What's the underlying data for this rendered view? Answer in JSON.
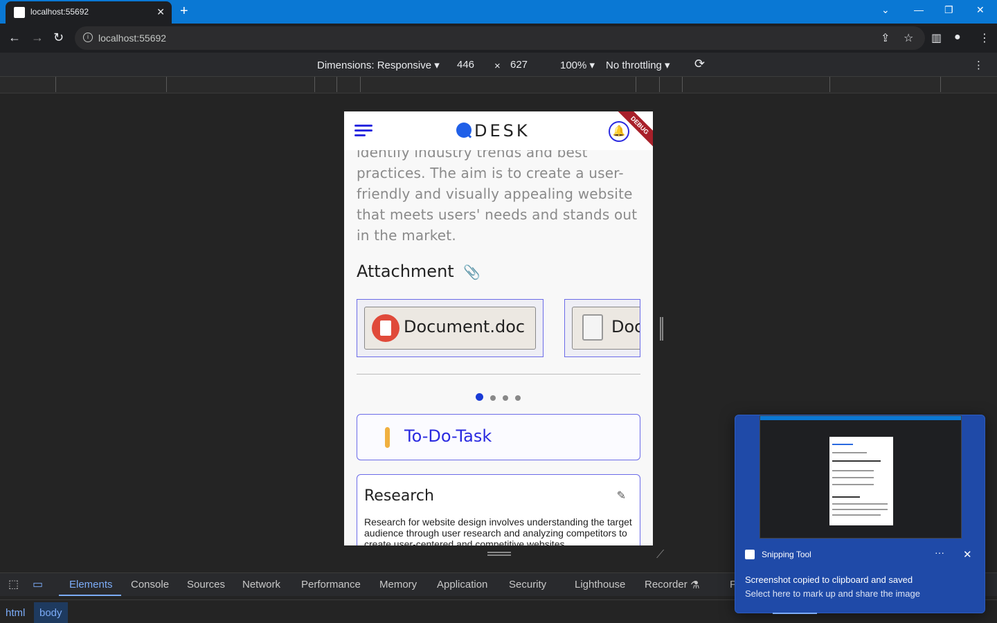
{
  "browser": {
    "tab_title": "localhost:55692",
    "url": "localhost:55692",
    "tab_close": "✕",
    "new_tab": "+"
  },
  "devtools_toolbar": {
    "dimensions": "Dimensions: Responsive",
    "width": "446",
    "times": "×",
    "height": "627",
    "zoom": "100%",
    "throttling": "No throttling"
  },
  "app": {
    "logo_text": "DESK",
    "debug_banner": "DEBUG",
    "description": "identify industry trends and best practices. The aim is to create a user-friendly and visually appealing website that meets users' needs and stands out in the market.",
    "attachment_title": "Attachment",
    "attachments": [
      {
        "name": "Document.doc"
      },
      {
        "name": "Doc"
      }
    ],
    "carousel_active_index": 0,
    "carousel_count": 4,
    "todo_label": "To-Do-Task",
    "task": {
      "title": "Research",
      "body": "Research for website design involves understanding the target audience through user research and analyzing competitors to create user-centered and competitive websites."
    }
  },
  "devtools_tabs": [
    "Elements",
    "Console",
    "Sources",
    "Network",
    "Performance",
    "Memory",
    "Application",
    "Security",
    "Lighthouse",
    "Recorder",
    "P"
  ],
  "devtools_active_tab": "Elements",
  "breadcrumbs": [
    "html",
    "body"
  ],
  "toast": {
    "app_name": "Snipping Tool",
    "more": "···",
    "close": "✕",
    "line1": "Screenshot copied to clipboard and saved",
    "line2": "Select here to mark up and share the image"
  },
  "colors": {
    "accent": "#2a2ae0",
    "browser_title_bar": "#0a78d4",
    "todo_marker": "#f0b040",
    "toast_bg": "#1f4aa8"
  }
}
